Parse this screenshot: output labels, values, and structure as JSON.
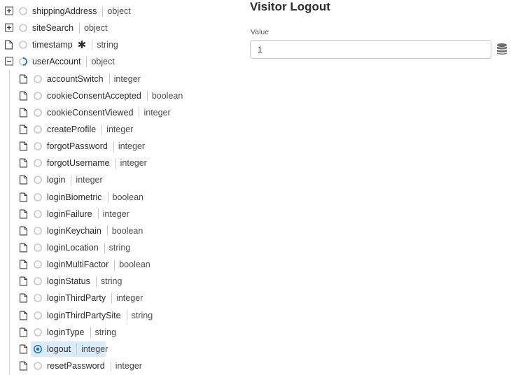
{
  "panel": {
    "title": "Visitor Logout",
    "value_label": "Value",
    "value": "1"
  },
  "tree": [
    {
      "name": "shippingAddress",
      "type": "object",
      "level": 0,
      "kind": "expandable",
      "expanded": false,
      "required": false,
      "selected": false
    },
    {
      "name": "siteSearch",
      "type": "object",
      "level": 0,
      "kind": "expandable",
      "expanded": false,
      "required": false,
      "selected": false
    },
    {
      "name": "timestamp",
      "type": "string",
      "level": 0,
      "kind": "leaf",
      "required": true,
      "selected": false
    },
    {
      "name": "userAccount",
      "type": "object",
      "level": 0,
      "kind": "expandable",
      "expanded": true,
      "required": false,
      "selected": false,
      "partial": true
    },
    {
      "name": "accountSwitch",
      "type": "integer",
      "level": 1,
      "kind": "leaf"
    },
    {
      "name": "cookieConsentAccepted",
      "type": "boolean",
      "level": 1,
      "kind": "leaf"
    },
    {
      "name": "cookieConsentViewed",
      "type": "integer",
      "level": 1,
      "kind": "leaf"
    },
    {
      "name": "createProfile",
      "type": "integer",
      "level": 1,
      "kind": "leaf"
    },
    {
      "name": "forgotPassword",
      "type": "integer",
      "level": 1,
      "kind": "leaf"
    },
    {
      "name": "forgotUsername",
      "type": "integer",
      "level": 1,
      "kind": "leaf"
    },
    {
      "name": "login",
      "type": "integer",
      "level": 1,
      "kind": "leaf"
    },
    {
      "name": "loginBiometric",
      "type": "boolean",
      "level": 1,
      "kind": "leaf"
    },
    {
      "name": "loginFailure",
      "type": "integer",
      "level": 1,
      "kind": "leaf"
    },
    {
      "name": "loginKeychain",
      "type": "boolean",
      "level": 1,
      "kind": "leaf"
    },
    {
      "name": "loginLocation",
      "type": "string",
      "level": 1,
      "kind": "leaf"
    },
    {
      "name": "loginMultiFactor",
      "type": "boolean",
      "level": 1,
      "kind": "leaf"
    },
    {
      "name": "loginStatus",
      "type": "string",
      "level": 1,
      "kind": "leaf"
    },
    {
      "name": "loginThirdParty",
      "type": "integer",
      "level": 1,
      "kind": "leaf"
    },
    {
      "name": "loginThirdPartySite",
      "type": "string",
      "level": 1,
      "kind": "leaf"
    },
    {
      "name": "loginType",
      "type": "string",
      "level": 1,
      "kind": "leaf"
    },
    {
      "name": "logout",
      "type": "integer",
      "level": 1,
      "kind": "leaf",
      "selected": true
    },
    {
      "name": "resetPassword",
      "type": "integer",
      "level": 1,
      "kind": "leaf"
    }
  ],
  "icons": {
    "expand": "plus-square-icon",
    "collapse": "minus-square-icon",
    "leaf": "document-icon",
    "radio": "radio-icon",
    "required": "asterisk-icon",
    "data_element": "database-icon"
  },
  "colors": {
    "accent": "#1473e6",
    "selected_bg": "#d9ecfb",
    "radio_border": "#c6c6c6"
  }
}
